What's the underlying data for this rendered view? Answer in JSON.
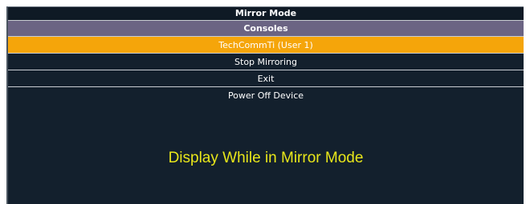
{
  "window": {
    "title": "Mirror Mode"
  },
  "section": {
    "label": "Consoles"
  },
  "menu": {
    "items": [
      {
        "label": "TechCommTi (User 1)",
        "selected": true
      },
      {
        "label": "Stop Mirroring",
        "selected": false
      },
      {
        "label": "Exit",
        "selected": false
      },
      {
        "label": "Power Off Device",
        "selected": false
      }
    ]
  },
  "caption": {
    "text": "Display While in Mirror Mode"
  },
  "colors": {
    "background": "#13202d",
    "header_band": "#6b6483",
    "selected_row": "#f5a50a",
    "caption": "#e8e61a",
    "divider": "#c8ccd2"
  }
}
